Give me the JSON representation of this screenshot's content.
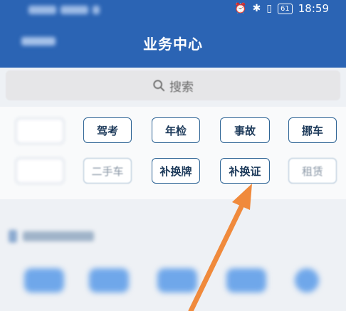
{
  "status_bar": {
    "time": "18:59",
    "battery": "61",
    "icons": [
      "alarm-icon",
      "bluetooth-icon",
      "vibrate-icon",
      "battery-icon"
    ]
  },
  "header": {
    "title": "业务中心"
  },
  "search": {
    "label": "搜索"
  },
  "services": {
    "row1": [
      "驾考",
      "年检",
      "事故",
      "挪车"
    ],
    "row2": [
      "二手车",
      "补换牌",
      "补换证",
      "租赁"
    ]
  },
  "colors": {
    "header_bg": "#2b64b4",
    "button_border": "#2e6495",
    "annotation_arrow": "#f08a3c"
  }
}
